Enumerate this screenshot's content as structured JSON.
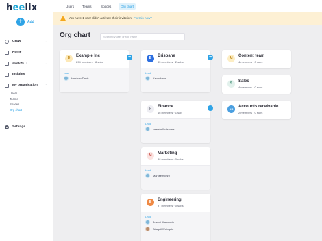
{
  "app": {
    "logo_prefix": "h",
    "logo_highlight": "ee",
    "logo_suffix": "lix",
    "add_label": "Add"
  },
  "sidebar": {
    "items": [
      {
        "label": "Grow",
        "badge": ""
      },
      {
        "label": "Home",
        "badge": ""
      },
      {
        "label": "Spaces",
        "badge": "1"
      },
      {
        "label": "Insights",
        "badge": ""
      },
      {
        "label": "My organisation",
        "badge": ""
      }
    ],
    "org_sub_items": [
      "Users",
      "Teams",
      "Spaces",
      "Org chart"
    ],
    "settings_label": "Settings"
  },
  "tabs": [
    "Users",
    "Teams",
    "Spaces",
    "Org chart"
  ],
  "active_tab": "Org chart",
  "warning": {
    "text": "You have 1 user didn't activate their invitation.",
    "link": "Fix this now?"
  },
  "page_title": "Org chart",
  "search": {
    "placeholder": "Search by user or role name"
  },
  "cards": {
    "example": {
      "initial": "D",
      "name": "Example Inc",
      "meta": "294 members  ·  8 subs",
      "lead_label": "Lead",
      "lead": "Harrison Davis"
    },
    "brisbane": {
      "initial": "B",
      "name": "Brisbane",
      "meta": "35 members  ·  2 subs",
      "lead_label": "Lead",
      "lead": "Kevin Hane"
    },
    "finance": {
      "initial": "F",
      "name": "Finance",
      "meta": "16 members  ·  1 sub",
      "lead_label": "Lead",
      "lead": "Lavada Kertzmann"
    },
    "marketing": {
      "initial": "M",
      "name": "Marketing",
      "meta": "38 members  ·  0 subs",
      "lead_label": "Lead",
      "lead": "Markee Kozzp"
    },
    "engineering": {
      "initial": "E",
      "name": "Engineering",
      "meta": "97 members  ·  0 subs",
      "lead_label": "Lead",
      "lead": "Avenui Allenworth",
      "lead2": "Abagail Weingate"
    },
    "content": {
      "initial": "M",
      "name": "Content team",
      "meta": "4 members  ·  0 subs"
    },
    "sales": {
      "initial": "S",
      "name": "Sales",
      "meta": "4 members  ·  0 subs"
    },
    "ar": {
      "initial": "AR",
      "name": "Accounts receivable",
      "meta": "2 members  ·  0 subs"
    }
  },
  "colors": {
    "accent": "#2ea3e6",
    "warning_bg": "#fdf0d4",
    "avatar_example": "#fde9b8",
    "avatar_brisbane": "#2d6fe0",
    "avatar_finance": "#eeeef3",
    "avatar_marketing": "#fbe3e1",
    "avatar_engineering": "#ef8a45",
    "avatar_content": "#fdeec4",
    "avatar_sales": "#e2f1ec",
    "avatar_ar": "#4a9fe0"
  },
  "icons": {
    "toggle": "−",
    "chevron": "⌄"
  }
}
